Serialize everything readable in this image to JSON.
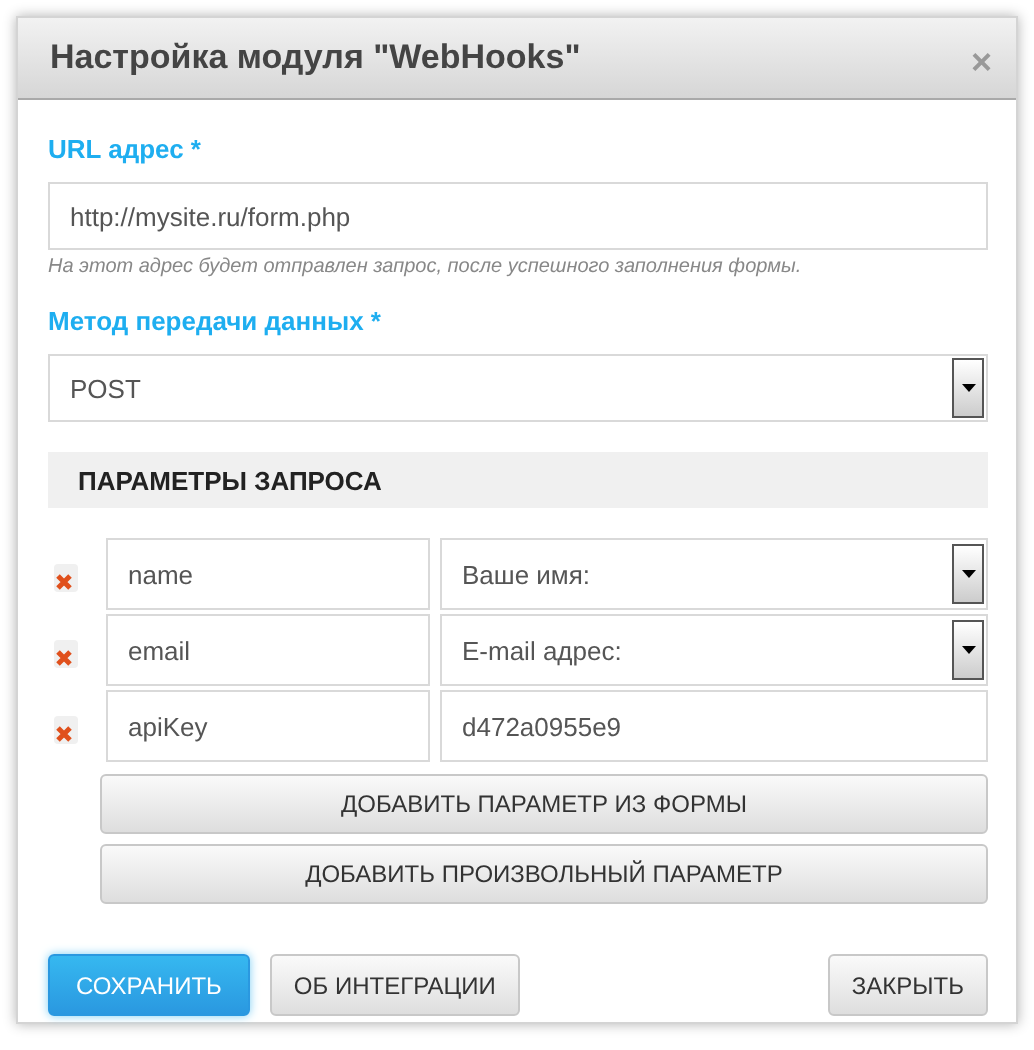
{
  "dialog": {
    "title": "Настройка модуля \"WebHooks\"",
    "close": "×"
  },
  "url": {
    "label": "URL адрес *",
    "value": "http://mysite.ru/form.php",
    "hint": "На этот адрес будет отправлен запрос, после успешного заполнения формы."
  },
  "method": {
    "label": "Метод передачи данных *",
    "value": "POST"
  },
  "params": {
    "heading": "ПАРАМЕТРЫ ЗАПРОСА",
    "rows": [
      {
        "name": "name",
        "kind": "select",
        "value": "Ваше имя:"
      },
      {
        "name": "email",
        "kind": "select",
        "value": "E-mail адрес:"
      },
      {
        "name": "apiKey",
        "kind": "text",
        "value": "d472a0955e9"
      }
    ],
    "buttons": [
      "ДОБАВИТЬ ПАРАМЕТР ИЗ ФОРМЫ",
      "ДОБАВИТЬ ПРОИЗВОЛЬНЫЙ ПАРАМЕТР"
    ]
  },
  "footer": [
    {
      "label": "СОХРАНИТЬ",
      "kind": "primary"
    },
    {
      "label": "ОБ ИНТЕГРАЦИИ",
      "kind": "default"
    },
    {
      "label": "ЗАКРЫТЬ",
      "kind": "right"
    }
  ]
}
